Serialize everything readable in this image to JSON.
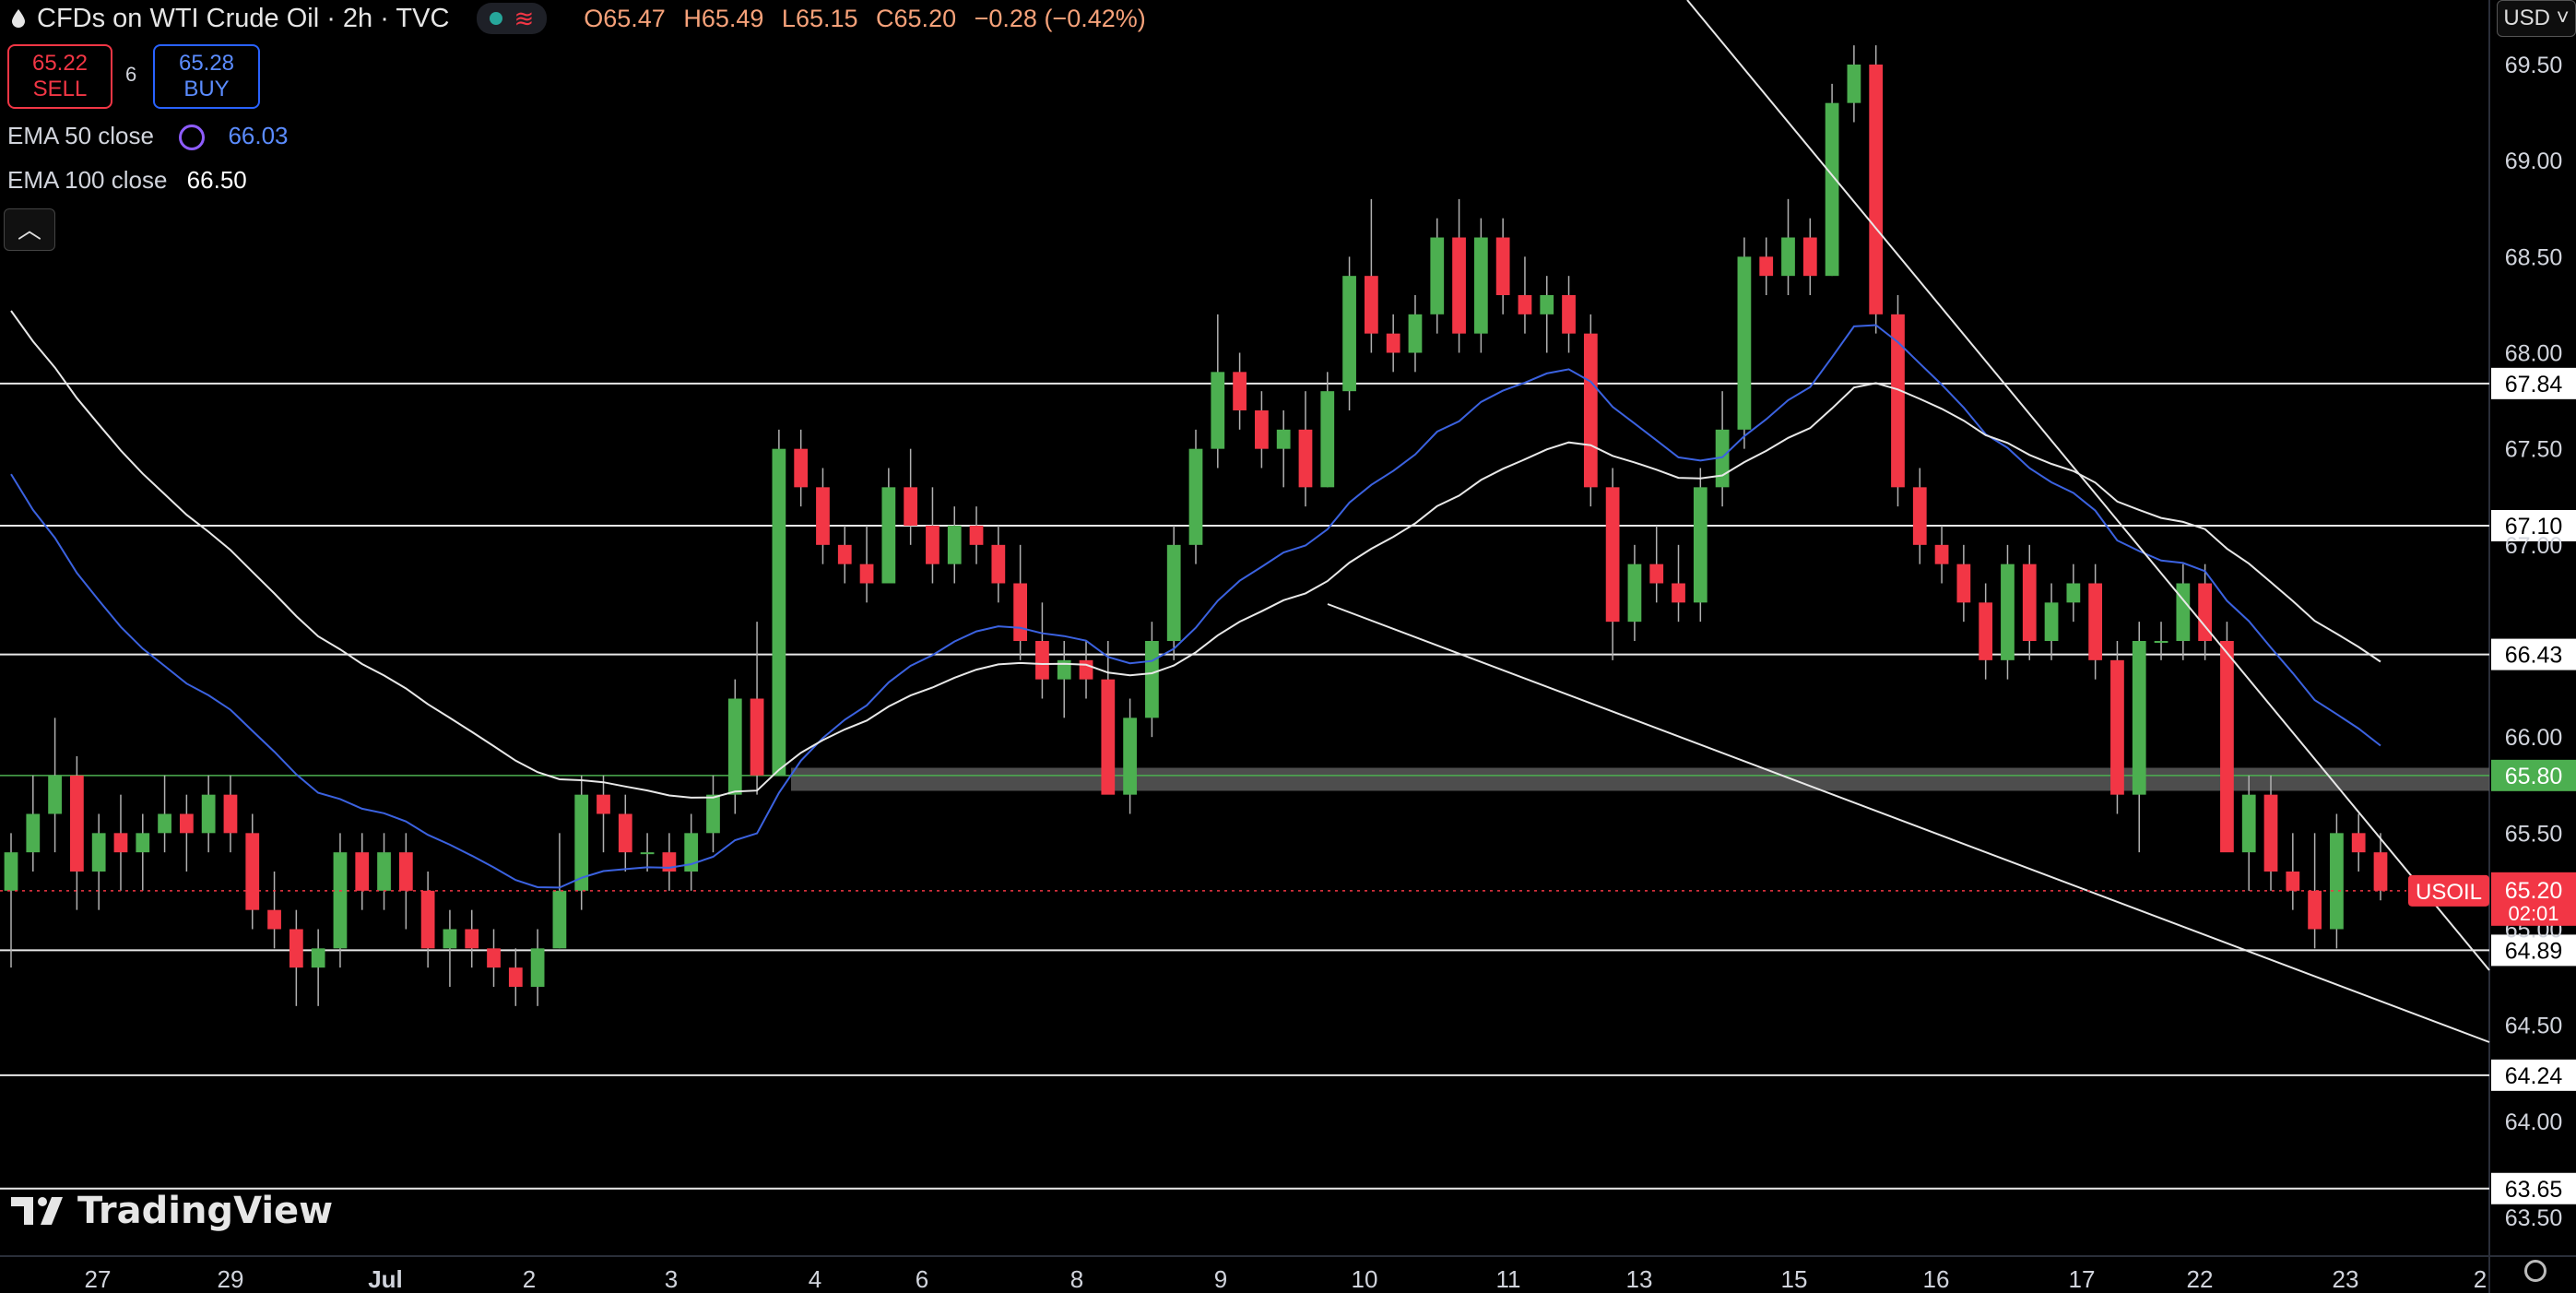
{
  "header": {
    "title": "CFDs on WTI Crude Oil · 2h · TVC",
    "ohlc": {
      "open": "O65.47",
      "high": "H65.49",
      "low": "L65.15",
      "close": "C65.20",
      "change": "−0.28 (−0.42%)"
    },
    "currency": "USD"
  },
  "trade": {
    "sell_price": "65.22",
    "sell_label": "SELL",
    "buy_price": "65.28",
    "buy_label": "BUY",
    "spread": "6"
  },
  "indicators": [
    {
      "label": "EMA 50 close",
      "value": "66.03",
      "color": "#3b62e0"
    },
    {
      "label": "EMA 100 close",
      "value": "66.50",
      "color": "#e8e8e8"
    }
  ],
  "branding": {
    "logo_text": "TradingView"
  },
  "colors": {
    "up": "#4caf50",
    "down": "#f23645",
    "background": "#000000",
    "zone": "#5a5a5a",
    "current_price_tag": "#f23645"
  },
  "chart_data": {
    "type": "candlestick",
    "symbol": "USOIL",
    "y_axis_ticks": [
      69.5,
      69.0,
      68.5,
      68.0,
      67.5,
      67.0,
      66.5,
      66.0,
      65.5,
      65.0,
      64.5,
      64.0,
      63.5
    ],
    "ylim": [
      63.3,
      69.8
    ],
    "x_axis_labels": [
      "27",
      "29",
      "Jul",
      "2",
      "3",
      "4",
      "6",
      "8",
      "9",
      "10",
      "11",
      "13",
      "15",
      "16",
      "17",
      "22",
      "23",
      "2"
    ],
    "horizontal_levels": [
      67.84,
      67.1,
      66.43,
      65.8,
      64.89,
      64.24,
      63.65
    ],
    "support_zone": [
      65.72,
      65.84
    ],
    "current_price": {
      "label": "USOIL",
      "value": "65.20",
      "countdown": "02:01"
    },
    "ema50_end": 66.03,
    "ema100_end": 66.5,
    "candles": [
      {
        "o": 65.2,
        "h": 65.5,
        "l": 64.8,
        "c": 65.4
      },
      {
        "o": 65.4,
        "h": 65.8,
        "l": 65.3,
        "c": 65.6
      },
      {
        "o": 65.6,
        "h": 66.1,
        "l": 65.4,
        "c": 65.8
      },
      {
        "o": 65.8,
        "h": 65.9,
        "l": 65.1,
        "c": 65.3
      },
      {
        "o": 65.3,
        "h": 65.6,
        "l": 65.1,
        "c": 65.5
      },
      {
        "o": 65.5,
        "h": 65.7,
        "l": 65.2,
        "c": 65.4
      },
      {
        "o": 65.4,
        "h": 65.6,
        "l": 65.2,
        "c": 65.5
      },
      {
        "o": 65.5,
        "h": 65.8,
        "l": 65.4,
        "c": 65.6
      },
      {
        "o": 65.6,
        "h": 65.7,
        "l": 65.3,
        "c": 65.5
      },
      {
        "o": 65.5,
        "h": 65.8,
        "l": 65.4,
        "c": 65.7
      },
      {
        "o": 65.7,
        "h": 65.8,
        "l": 65.4,
        "c": 65.5
      },
      {
        "o": 65.5,
        "h": 65.6,
        "l": 65.0,
        "c": 65.1
      },
      {
        "o": 65.1,
        "h": 65.3,
        "l": 64.9,
        "c": 65.0
      },
      {
        "o": 65.0,
        "h": 65.1,
        "l": 64.6,
        "c": 64.8
      },
      {
        "o": 64.8,
        "h": 65.0,
        "l": 64.6,
        "c": 64.9
      },
      {
        "o": 64.9,
        "h": 65.5,
        "l": 64.8,
        "c": 65.4
      },
      {
        "o": 65.4,
        "h": 65.5,
        "l": 65.1,
        "c": 65.2
      },
      {
        "o": 65.2,
        "h": 65.5,
        "l": 65.1,
        "c": 65.4
      },
      {
        "o": 65.4,
        "h": 65.5,
        "l": 65.0,
        "c": 65.2
      },
      {
        "o": 65.2,
        "h": 65.3,
        "l": 64.8,
        "c": 64.9
      },
      {
        "o": 64.9,
        "h": 65.1,
        "l": 64.7,
        "c": 65.0
      },
      {
        "o": 65.0,
        "h": 65.1,
        "l": 64.8,
        "c": 64.9
      },
      {
        "o": 64.9,
        "h": 65.0,
        "l": 64.7,
        "c": 64.8
      },
      {
        "o": 64.8,
        "h": 64.9,
        "l": 64.6,
        "c": 64.7
      },
      {
        "o": 64.7,
        "h": 65.0,
        "l": 64.6,
        "c": 64.9
      },
      {
        "o": 64.9,
        "h": 65.5,
        "l": 64.9,
        "c": 65.2
      },
      {
        "o": 65.2,
        "h": 65.8,
        "l": 65.1,
        "c": 65.7
      },
      {
        "o": 65.7,
        "h": 65.8,
        "l": 65.4,
        "c": 65.6
      },
      {
        "o": 65.6,
        "h": 65.7,
        "l": 65.3,
        "c": 65.4
      },
      {
        "o": 65.4,
        "h": 65.5,
        "l": 65.3,
        "c": 65.4
      },
      {
        "o": 65.4,
        "h": 65.5,
        "l": 65.2,
        "c": 65.3
      },
      {
        "o": 65.3,
        "h": 65.6,
        "l": 65.2,
        "c": 65.5
      },
      {
        "o": 65.5,
        "h": 65.8,
        "l": 65.4,
        "c": 65.7
      },
      {
        "o": 65.7,
        "h": 66.3,
        "l": 65.6,
        "c": 66.2
      },
      {
        "o": 66.2,
        "h": 66.6,
        "l": 65.7,
        "c": 65.8
      },
      {
        "o": 65.8,
        "h": 67.6,
        "l": 65.8,
        "c": 67.5
      },
      {
        "o": 67.5,
        "h": 67.6,
        "l": 67.2,
        "c": 67.3
      },
      {
        "o": 67.3,
        "h": 67.4,
        "l": 66.9,
        "c": 67.0
      },
      {
        "o": 67.0,
        "h": 67.1,
        "l": 66.8,
        "c": 66.9
      },
      {
        "o": 66.9,
        "h": 67.1,
        "l": 66.7,
        "c": 66.8
      },
      {
        "o": 66.8,
        "h": 67.4,
        "l": 66.8,
        "c": 67.3
      },
      {
        "o": 67.3,
        "h": 67.5,
        "l": 67.0,
        "c": 67.1
      },
      {
        "o": 67.1,
        "h": 67.3,
        "l": 66.8,
        "c": 66.9
      },
      {
        "o": 66.9,
        "h": 67.2,
        "l": 66.8,
        "c": 67.1
      },
      {
        "o": 67.1,
        "h": 67.2,
        "l": 66.9,
        "c": 67.0
      },
      {
        "o": 67.0,
        "h": 67.1,
        "l": 66.7,
        "c": 66.8
      },
      {
        "o": 66.8,
        "h": 67.0,
        "l": 66.4,
        "c": 66.5
      },
      {
        "o": 66.5,
        "h": 66.7,
        "l": 66.2,
        "c": 66.3
      },
      {
        "o": 66.3,
        "h": 66.5,
        "l": 66.1,
        "c": 66.4
      },
      {
        "o": 66.4,
        "h": 66.5,
        "l": 66.2,
        "c": 66.3
      },
      {
        "o": 66.3,
        "h": 66.5,
        "l": 65.9,
        "c": 65.7
      },
      {
        "o": 65.7,
        "h": 66.2,
        "l": 65.6,
        "c": 66.1
      },
      {
        "o": 66.1,
        "h": 66.6,
        "l": 66.0,
        "c": 66.5
      },
      {
        "o": 66.5,
        "h": 67.1,
        "l": 66.4,
        "c": 67.0
      },
      {
        "o": 67.0,
        "h": 67.6,
        "l": 66.9,
        "c": 67.5
      },
      {
        "o": 67.5,
        "h": 68.2,
        "l": 67.4,
        "c": 67.9
      },
      {
        "o": 67.9,
        "h": 68.0,
        "l": 67.6,
        "c": 67.7
      },
      {
        "o": 67.7,
        "h": 67.8,
        "l": 67.4,
        "c": 67.5
      },
      {
        "o": 67.5,
        "h": 67.7,
        "l": 67.3,
        "c": 67.6
      },
      {
        "o": 67.6,
        "h": 67.8,
        "l": 67.2,
        "c": 67.3
      },
      {
        "o": 67.3,
        "h": 67.9,
        "l": 67.3,
        "c": 67.8
      },
      {
        "o": 67.8,
        "h": 68.5,
        "l": 67.7,
        "c": 68.4
      },
      {
        "o": 68.4,
        "h": 68.8,
        "l": 68.0,
        "c": 68.1
      },
      {
        "o": 68.1,
        "h": 68.2,
        "l": 67.9,
        "c": 68.0
      },
      {
        "o": 68.0,
        "h": 68.3,
        "l": 67.9,
        "c": 68.2
      },
      {
        "o": 68.2,
        "h": 68.7,
        "l": 68.1,
        "c": 68.6
      },
      {
        "o": 68.6,
        "h": 68.8,
        "l": 68.0,
        "c": 68.1
      },
      {
        "o": 68.1,
        "h": 68.7,
        "l": 68.0,
        "c": 68.6
      },
      {
        "o": 68.6,
        "h": 68.7,
        "l": 68.2,
        "c": 68.3
      },
      {
        "o": 68.3,
        "h": 68.5,
        "l": 68.1,
        "c": 68.2
      },
      {
        "o": 68.2,
        "h": 68.4,
        "l": 68.0,
        "c": 68.3
      },
      {
        "o": 68.3,
        "h": 68.4,
        "l": 68.0,
        "c": 68.1
      },
      {
        "o": 68.1,
        "h": 68.2,
        "l": 67.2,
        "c": 67.3
      },
      {
        "o": 67.3,
        "h": 67.4,
        "l": 66.4,
        "c": 66.6
      },
      {
        "o": 66.6,
        "h": 67.0,
        "l": 66.5,
        "c": 66.9
      },
      {
        "o": 66.9,
        "h": 67.1,
        "l": 66.7,
        "c": 66.8
      },
      {
        "o": 66.8,
        "h": 67.0,
        "l": 66.6,
        "c": 66.7
      },
      {
        "o": 66.7,
        "h": 67.4,
        "l": 66.6,
        "c": 67.3
      },
      {
        "o": 67.3,
        "h": 67.8,
        "l": 67.2,
        "c": 67.6
      },
      {
        "o": 67.6,
        "h": 68.6,
        "l": 67.5,
        "c": 68.5
      },
      {
        "o": 68.5,
        "h": 68.6,
        "l": 68.3,
        "c": 68.4
      },
      {
        "o": 68.4,
        "h": 68.8,
        "l": 68.3,
        "c": 68.6
      },
      {
        "o": 68.6,
        "h": 68.7,
        "l": 68.3,
        "c": 68.4
      },
      {
        "o": 68.4,
        "h": 69.4,
        "l": 68.4,
        "c": 69.3
      },
      {
        "o": 69.3,
        "h": 69.6,
        "l": 69.2,
        "c": 69.5
      },
      {
        "o": 69.5,
        "h": 69.6,
        "l": 68.1,
        "c": 68.2
      },
      {
        "o": 68.2,
        "h": 68.3,
        "l": 67.2,
        "c": 67.3
      },
      {
        "o": 67.3,
        "h": 67.4,
        "l": 66.9,
        "c": 67.0
      },
      {
        "o": 67.0,
        "h": 67.1,
        "l": 66.8,
        "c": 66.9
      },
      {
        "o": 66.9,
        "h": 67.0,
        "l": 66.6,
        "c": 66.7
      },
      {
        "o": 66.7,
        "h": 66.8,
        "l": 66.3,
        "c": 66.4
      },
      {
        "o": 66.4,
        "h": 67.0,
        "l": 66.3,
        "c": 66.9
      },
      {
        "o": 66.9,
        "h": 67.0,
        "l": 66.4,
        "c": 66.5
      },
      {
        "o": 66.5,
        "h": 66.8,
        "l": 66.4,
        "c": 66.7
      },
      {
        "o": 66.7,
        "h": 66.9,
        "l": 66.6,
        "c": 66.8
      },
      {
        "o": 66.8,
        "h": 66.9,
        "l": 66.3,
        "c": 66.4
      },
      {
        "o": 66.4,
        "h": 66.5,
        "l": 65.6,
        "c": 65.7
      },
      {
        "o": 65.7,
        "h": 66.6,
        "l": 65.4,
        "c": 66.5
      },
      {
        "o": 66.5,
        "h": 66.6,
        "l": 66.4,
        "c": 66.5
      },
      {
        "o": 66.5,
        "h": 66.9,
        "l": 66.4,
        "c": 66.8
      },
      {
        "o": 66.8,
        "h": 66.9,
        "l": 66.4,
        "c": 66.5
      },
      {
        "o": 66.5,
        "h": 66.6,
        "l": 65.6,
        "c": 65.4
      },
      {
        "o": 65.4,
        "h": 65.8,
        "l": 65.2,
        "c": 65.7
      },
      {
        "o": 65.7,
        "h": 65.8,
        "l": 65.2,
        "c": 65.3
      },
      {
        "o": 65.3,
        "h": 65.5,
        "l": 65.1,
        "c": 65.2
      },
      {
        "o": 65.2,
        "h": 65.5,
        "l": 64.9,
        "c": 65.0
      },
      {
        "o": 65.0,
        "h": 65.6,
        "l": 64.9,
        "c": 65.5
      },
      {
        "o": 65.5,
        "h": 65.6,
        "l": 65.3,
        "c": 65.4
      },
      {
        "o": 65.4,
        "h": 65.5,
        "l": 65.15,
        "c": 65.2
      }
    ]
  }
}
